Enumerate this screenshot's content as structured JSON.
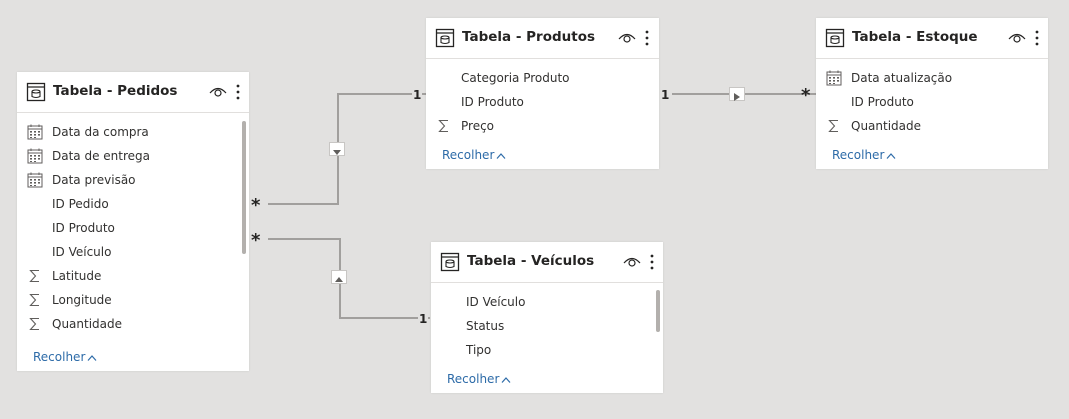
{
  "tables": {
    "pedidos": {
      "title": "Tabela - Pedidos",
      "collapse_label": "Recolher",
      "fields": [
        {
          "icon": "calendar-icon",
          "name": "Data da compra"
        },
        {
          "icon": "calendar-icon",
          "name": "Data de entrega"
        },
        {
          "icon": "calendar-icon",
          "name": "Data previsão"
        },
        {
          "icon": "none",
          "name": "ID Pedido"
        },
        {
          "icon": "none",
          "name": "ID Produto"
        },
        {
          "icon": "none",
          "name": "ID Veículo"
        },
        {
          "icon": "sigma-icon",
          "name": "Latitude"
        },
        {
          "icon": "sigma-icon",
          "name": "Longitude"
        },
        {
          "icon": "sigma-icon",
          "name": "Quantidade"
        }
      ]
    },
    "produtos": {
      "title": "Tabela - Produtos",
      "collapse_label": "Recolher",
      "fields": [
        {
          "icon": "none",
          "name": "Categoria Produto"
        },
        {
          "icon": "none",
          "name": "ID Produto"
        },
        {
          "icon": "sigma-icon",
          "name": "Preço"
        }
      ]
    },
    "estoque": {
      "title": "Tabela - Estoque",
      "collapse_label": "Recolher",
      "fields": [
        {
          "icon": "calendar-icon",
          "name": "Data atualização"
        },
        {
          "icon": "none",
          "name": "ID Produto"
        },
        {
          "icon": "sigma-icon",
          "name": "Quantidade"
        }
      ]
    },
    "veiculos": {
      "title": "Tabela - Veículos",
      "collapse_label": "Recolher",
      "fields": [
        {
          "icon": "none",
          "name": "ID Veículo"
        },
        {
          "icon": "none",
          "name": "Status"
        },
        {
          "icon": "none",
          "name": "Tipo"
        }
      ]
    }
  },
  "relationships": {
    "pedidos_produtos": {
      "many": "*",
      "one": "1"
    },
    "produtos_estoque": {
      "one": "1",
      "many": "*"
    },
    "pedidos_veiculos": {
      "many": "*",
      "one": "1"
    }
  },
  "colors": {
    "canvas": "#e2e1e0",
    "card": "#ffffff",
    "line": "#a19f9d",
    "link": "#2d6ba8"
  }
}
